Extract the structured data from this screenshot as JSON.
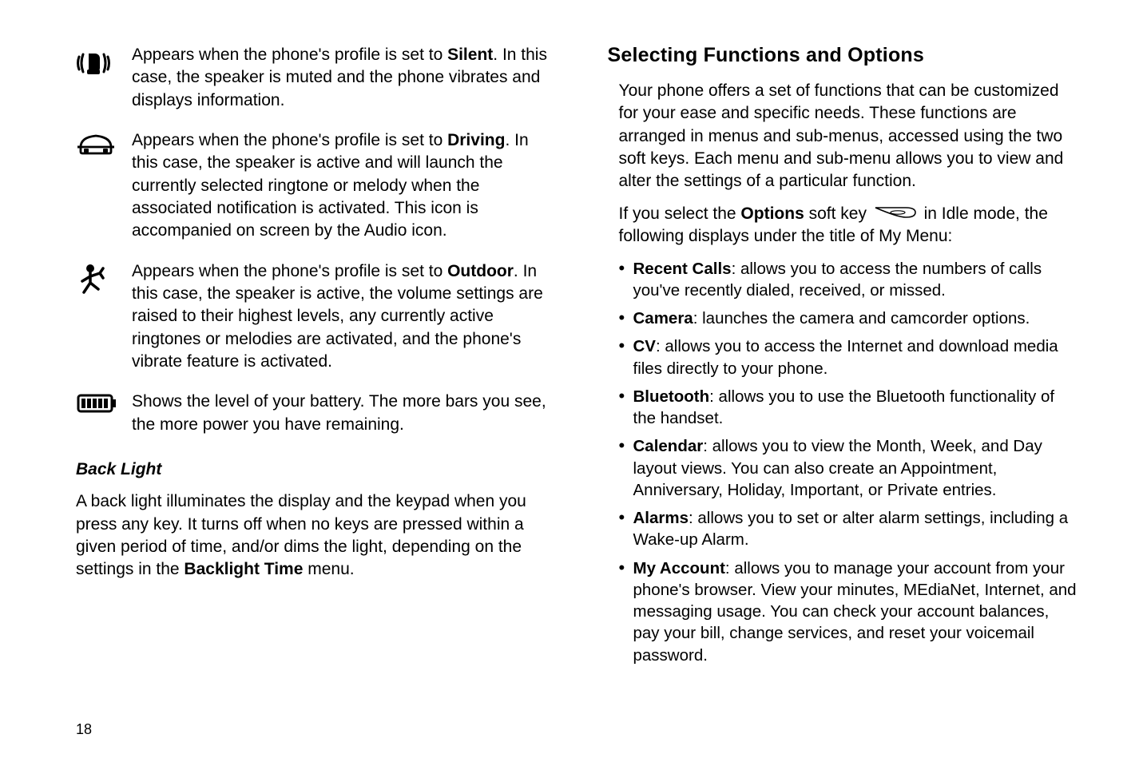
{
  "left": {
    "rows": [
      {
        "icon": "vibrate-icon",
        "pre": "Appears when the phone's profile is set to ",
        "bold": "Silent",
        "post": ". In this case, the speaker is muted and the phone vibrates and displays information."
      },
      {
        "icon": "car-icon",
        "pre": "Appears when the phone's profile is set to ",
        "bold": "Driving",
        "post": ". In this case, the speaker is active and will launch the currently selected ringtone or melody when the associated notification is activated. This icon is accompanied on screen by the Audio icon."
      },
      {
        "icon": "outdoor-icon",
        "pre": "Appears when the phone's profile is set to ",
        "bold": "Outdoor",
        "post": ". In this case, the speaker is active, the volume settings are raised to their highest levels, any currently active ringtones or melodies are activated, and the phone's vibrate feature is activated."
      },
      {
        "icon": "battery-icon",
        "pre": "Shows the level of your battery. The more bars you see, the more power you have remaining.",
        "bold": "",
        "post": ""
      }
    ],
    "subhead": "Back Light",
    "backlight_pre": "A back light illuminates the display and the keypad when you press any key. It turns off when no keys are pressed within a given period of time, and/or dims the light, depending on the settings in the ",
    "backlight_bold": "Backlight Time",
    "backlight_post": " menu."
  },
  "right": {
    "heading": "Selecting Functions and Options",
    "intro": "Your phone offers a set of functions that can be customized for your ease and specific needs. These functions are arranged in menus and sub-menus, accessed using the two soft keys. Each menu and sub-menu allows you to view and alter the settings of a particular function.",
    "options_pre": "If you select the ",
    "options_bold": "Options",
    "options_mid": " soft key ",
    "options_post": " in Idle mode, the following displays under the title of My Menu:",
    "bullets": [
      {
        "bold": "Recent Calls",
        "text": ": allows you to access the numbers of calls you've recently dialed, received, or missed."
      },
      {
        "bold": "Camera",
        "text": ": launches the camera and camcorder options."
      },
      {
        "bold": "CV",
        "text": ": allows you to access the Internet and download media files directly to your phone."
      },
      {
        "bold": "Bluetooth",
        "text": ": allows you to use the Bluetooth functionality of the handset."
      },
      {
        "bold": "Calendar",
        "text": ": allows you to view the Month, Week, and Day layout views. You can also create an Appointment, Anniversary, Holiday, Important, or Private entries."
      },
      {
        "bold": "Alarms",
        "text": ": allows you to set or alter alarm settings, including a Wake-up Alarm."
      },
      {
        "bold": "My Account",
        "text": ": allows you to manage your account from your phone's browser. View your minutes, MEdiaNet, Internet, and messaging usage. You can check your account balances, pay your bill, change services, and reset your voicemail password."
      }
    ]
  },
  "page": "18"
}
